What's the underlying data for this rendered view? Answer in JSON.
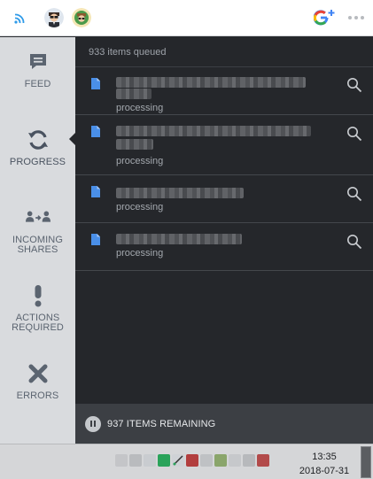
{
  "topbar": {
    "icons": [
      "wifi-icon",
      "avatar-icon",
      "avatar-icon",
      "google-plus-icon",
      "more-icon"
    ],
    "brand_color": "#2f9be9"
  },
  "sidebar": {
    "items": [
      {
        "label": "FEED",
        "icon": "feed-icon"
      },
      {
        "label": "PROGRESS",
        "icon": "sync-icon",
        "active": true
      },
      {
        "label": "INCOMING\nSHARES",
        "icon": "incoming-shares-icon"
      },
      {
        "label": "ACTIONS\nREQUIRED",
        "icon": "exclamation-icon"
      },
      {
        "label": "ERRORS",
        "icon": "x-icon"
      }
    ]
  },
  "queue": {
    "header": "933 items queued",
    "rows": [
      {
        "status": "processing",
        "two_line_name": true
      },
      {
        "status": "processing",
        "two_line_name": true
      },
      {
        "status": "processing",
        "two_line_name": false
      },
      {
        "status": "processing",
        "two_line_name": false
      }
    ]
  },
  "footer": {
    "remaining": "937 ITEMS REMAINING"
  },
  "taskbar": {
    "time": "13:35",
    "date": "2018-07-31"
  },
  "colors": {
    "panel": "#25272b",
    "sidebar": "#d9dbde",
    "file_blue": "#4a8fe8",
    "text_muted": "#a3a8ae"
  }
}
